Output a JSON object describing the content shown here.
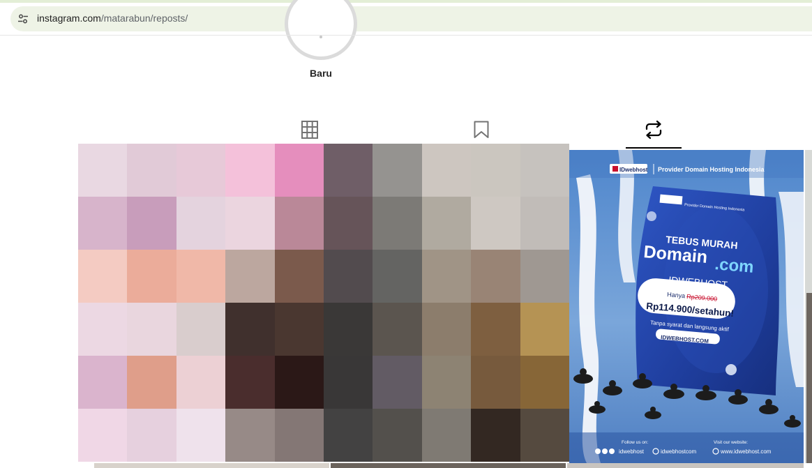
{
  "browser": {
    "url_host": "instagram.com",
    "url_path": "/matarabun/reposts/",
    "site_info_icon": "tune-icon"
  },
  "highlight": {
    "label": "Baru"
  },
  "tabs": [
    {
      "name": "posts",
      "icon": "grid-icon",
      "active": false
    },
    {
      "name": "saved",
      "icon": "bookmark-icon",
      "active": false
    },
    {
      "name": "reposts",
      "icon": "repost-icon",
      "active": true
    }
  ],
  "pixelated_post_colors": [
    "#e9d8e2",
    "#e1cad7",
    "#e7c9d8",
    "#f4c1da",
    "#e58ebd",
    "#6f5e67",
    "#959390",
    "#cdc6c0",
    "#cbc6bf",
    "#c6c2be",
    "#d7b4cb",
    "#c89dbb",
    "#e4d3de",
    "#ebd5df",
    "#ba8898",
    "#665459",
    "#7c7a76",
    "#b0aaa0",
    "#cec8c2",
    "#c1bcb8",
    "#f4cbc2",
    "#ebac9a",
    "#f0b8a8",
    "#bca79f",
    "#7b5a4c",
    "#524b4e",
    "#646462",
    "#a09486",
    "#998475",
    "#9f9892",
    "#ecd8e3",
    "#e9d6de",
    "#d9cdcd",
    "#40302d",
    "#4a3730",
    "#3a3837",
    "#5b554f",
    "#8c7d6c",
    "#7e5f40",
    "#b59354",
    "#dab4cd",
    "#df9e8a",
    "#ecd0d4",
    "#4a2d2d",
    "#2b1817",
    "#393737",
    "#625b64",
    "#8d8373",
    "#775a3d",
    "#876637",
    "#f0d7e6",
    "#e6d0de",
    "#efe2ec",
    "#978a87",
    "#847775",
    "#434242",
    "#53504c",
    "#7f7a73",
    "#332822",
    "#554a3f"
  ],
  "repost_ad": {
    "brand": "IDwebhost",
    "header_tagline": "Provider Domain Hosting Indonesia",
    "bag_tagline": "Provider Domain Hosting Indonesia",
    "headline": "TEBUS MURAH",
    "product_domain": "Domain",
    "product_tld": ".com",
    "company": "IDWEBHOST",
    "price_prefix": "Hanya",
    "old_price": "Rp209.000",
    "new_price": "Rp114.900/setahun!",
    "condition": "Tanpa syarat dan langsung aktif",
    "site_button": "IDWEBHOST.COM",
    "follow_label": "Follow us on:",
    "social_handle": "idwebhost",
    "instagram_handle": "idwebhostcom",
    "visit_label": "Visit our website:",
    "website": "www.idwebhost.com",
    "colors": {
      "sky": "#6f9fd6",
      "bag": "#2344a8",
      "smoke": "#ffffff",
      "accent": "#c8102e"
    }
  }
}
